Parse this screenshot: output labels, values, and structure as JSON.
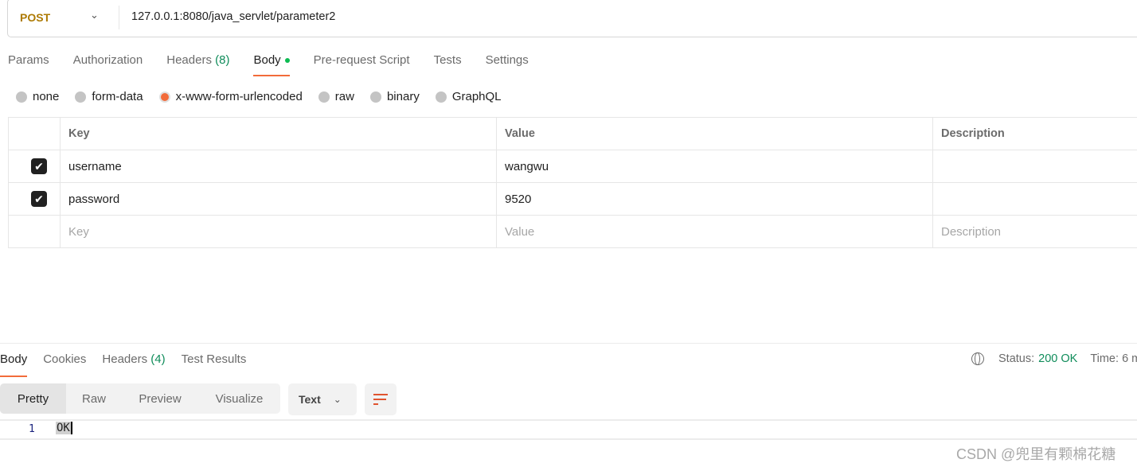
{
  "request": {
    "method": "POST",
    "url": "127.0.0.1:8080/java_servlet/parameter2"
  },
  "tabs": [
    {
      "label": "Params"
    },
    {
      "label": "Authorization"
    },
    {
      "label": "Headers",
      "count": "(8)"
    },
    {
      "label": "Body",
      "active": true,
      "dot": true
    },
    {
      "label": "Pre-request Script"
    },
    {
      "label": "Tests"
    },
    {
      "label": "Settings"
    }
  ],
  "body_types": [
    "none",
    "form-data",
    "x-www-form-urlencoded",
    "raw",
    "binary",
    "GraphQL"
  ],
  "body_type_selected": "x-www-form-urlencoded",
  "table": {
    "headers": {
      "key": "Key",
      "value": "Value",
      "description": "Description"
    },
    "rows": [
      {
        "checked": true,
        "key": "username",
        "value": "wangwu",
        "description": ""
      },
      {
        "checked": true,
        "key": "password",
        "value": "9520",
        "description": ""
      }
    ],
    "placeholders": {
      "key": "Key",
      "value": "Value",
      "description": "Description"
    }
  },
  "response": {
    "tabs": [
      {
        "label": "Body"
      },
      {
        "label": "Cookies"
      },
      {
        "label": "Headers",
        "count": "(4)"
      },
      {
        "label": "Test Results"
      }
    ],
    "status_label": "Status:",
    "status_value": "200 OK",
    "time_label": "Time:",
    "time_value": "6 m",
    "views": [
      "Pretty",
      "Raw",
      "Preview",
      "Visualize"
    ],
    "format": "Text",
    "lines": [
      {
        "num": "1",
        "text": "OK"
      }
    ]
  },
  "colors": {
    "accent": "#f26b3a",
    "method": "#ad7a03",
    "success": "#0f8c5a",
    "dot": "#0cbb52"
  },
  "watermark": "CSDN @兜里有颗棉花糖"
}
